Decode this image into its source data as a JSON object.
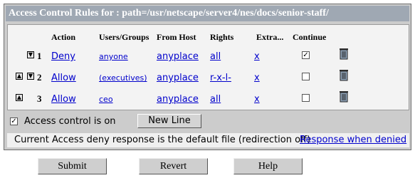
{
  "title": "Access Control Rules for : path=/usr/netscape/server4/nes/docs/senior-staff/",
  "columns": {
    "action": "Action",
    "users_groups": "Users/Groups",
    "from_host": "From Host",
    "rights": "Rights",
    "extra": "Extra...",
    "continue": "Continue"
  },
  "rows": [
    {
      "num": "1",
      "action": "Deny",
      "users": "anyone",
      "host": "anyplace",
      "rights": "all",
      "extra": "x",
      "continue": "✓",
      "has_up": false,
      "has_down": true
    },
    {
      "num": "2",
      "action": "Allow",
      "users": "(executives)",
      "host": "anyplace",
      "rights": "r-x-l-",
      "extra": "x",
      "continue": "",
      "has_up": true,
      "has_down": true
    },
    {
      "num": "3",
      "action": "Allow",
      "users": "ceo",
      "host": "anyplace",
      "rights": "all",
      "extra": "x",
      "continue": "",
      "has_up": true,
      "has_down": false
    }
  ],
  "access_control_label": "Access control is on",
  "access_control_checked": "✓",
  "new_line_label": "New Line",
  "deny_response_text": "Current Access deny response is  the default file (redirection off)",
  "deny_response_link": "Response when denied",
  "buttons": {
    "submit": "Submit",
    "revert": "Revert",
    "help": "Help"
  },
  "icons": {
    "up": "up-arrow-icon",
    "down": "down-arrow-icon",
    "trash": "trash-icon"
  }
}
